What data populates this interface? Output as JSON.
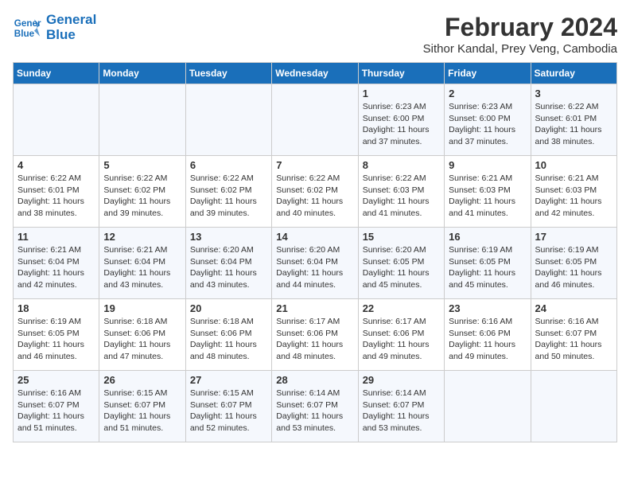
{
  "logo": {
    "line1": "General",
    "line2": "Blue"
  },
  "title": "February 2024",
  "subtitle": "Sithor Kandal, Prey Veng, Cambodia",
  "headers": [
    "Sunday",
    "Monday",
    "Tuesday",
    "Wednesday",
    "Thursday",
    "Friday",
    "Saturday"
  ],
  "weeks": [
    [
      {
        "day": "",
        "info": ""
      },
      {
        "day": "",
        "info": ""
      },
      {
        "day": "",
        "info": ""
      },
      {
        "day": "",
        "info": ""
      },
      {
        "day": "1",
        "info": "Sunrise: 6:23 AM\nSunset: 6:00 PM\nDaylight: 11 hours\nand 37 minutes."
      },
      {
        "day": "2",
        "info": "Sunrise: 6:23 AM\nSunset: 6:00 PM\nDaylight: 11 hours\nand 37 minutes."
      },
      {
        "day": "3",
        "info": "Sunrise: 6:22 AM\nSunset: 6:01 PM\nDaylight: 11 hours\nand 38 minutes."
      }
    ],
    [
      {
        "day": "4",
        "info": "Sunrise: 6:22 AM\nSunset: 6:01 PM\nDaylight: 11 hours\nand 38 minutes."
      },
      {
        "day": "5",
        "info": "Sunrise: 6:22 AM\nSunset: 6:02 PM\nDaylight: 11 hours\nand 39 minutes."
      },
      {
        "day": "6",
        "info": "Sunrise: 6:22 AM\nSunset: 6:02 PM\nDaylight: 11 hours\nand 39 minutes."
      },
      {
        "day": "7",
        "info": "Sunrise: 6:22 AM\nSunset: 6:02 PM\nDaylight: 11 hours\nand 40 minutes."
      },
      {
        "day": "8",
        "info": "Sunrise: 6:22 AM\nSunset: 6:03 PM\nDaylight: 11 hours\nand 41 minutes."
      },
      {
        "day": "9",
        "info": "Sunrise: 6:21 AM\nSunset: 6:03 PM\nDaylight: 11 hours\nand 41 minutes."
      },
      {
        "day": "10",
        "info": "Sunrise: 6:21 AM\nSunset: 6:03 PM\nDaylight: 11 hours\nand 42 minutes."
      }
    ],
    [
      {
        "day": "11",
        "info": "Sunrise: 6:21 AM\nSunset: 6:04 PM\nDaylight: 11 hours\nand 42 minutes."
      },
      {
        "day": "12",
        "info": "Sunrise: 6:21 AM\nSunset: 6:04 PM\nDaylight: 11 hours\nand 43 minutes."
      },
      {
        "day": "13",
        "info": "Sunrise: 6:20 AM\nSunset: 6:04 PM\nDaylight: 11 hours\nand 43 minutes."
      },
      {
        "day": "14",
        "info": "Sunrise: 6:20 AM\nSunset: 6:04 PM\nDaylight: 11 hours\nand 44 minutes."
      },
      {
        "day": "15",
        "info": "Sunrise: 6:20 AM\nSunset: 6:05 PM\nDaylight: 11 hours\nand 45 minutes."
      },
      {
        "day": "16",
        "info": "Sunrise: 6:19 AM\nSunset: 6:05 PM\nDaylight: 11 hours\nand 45 minutes."
      },
      {
        "day": "17",
        "info": "Sunrise: 6:19 AM\nSunset: 6:05 PM\nDaylight: 11 hours\nand 46 minutes."
      }
    ],
    [
      {
        "day": "18",
        "info": "Sunrise: 6:19 AM\nSunset: 6:05 PM\nDaylight: 11 hours\nand 46 minutes."
      },
      {
        "day": "19",
        "info": "Sunrise: 6:18 AM\nSunset: 6:06 PM\nDaylight: 11 hours\nand 47 minutes."
      },
      {
        "day": "20",
        "info": "Sunrise: 6:18 AM\nSunset: 6:06 PM\nDaylight: 11 hours\nand 48 minutes."
      },
      {
        "day": "21",
        "info": "Sunrise: 6:17 AM\nSunset: 6:06 PM\nDaylight: 11 hours\nand 48 minutes."
      },
      {
        "day": "22",
        "info": "Sunrise: 6:17 AM\nSunset: 6:06 PM\nDaylight: 11 hours\nand 49 minutes."
      },
      {
        "day": "23",
        "info": "Sunrise: 6:16 AM\nSunset: 6:06 PM\nDaylight: 11 hours\nand 49 minutes."
      },
      {
        "day": "24",
        "info": "Sunrise: 6:16 AM\nSunset: 6:07 PM\nDaylight: 11 hours\nand 50 minutes."
      }
    ],
    [
      {
        "day": "25",
        "info": "Sunrise: 6:16 AM\nSunset: 6:07 PM\nDaylight: 11 hours\nand 51 minutes."
      },
      {
        "day": "26",
        "info": "Sunrise: 6:15 AM\nSunset: 6:07 PM\nDaylight: 11 hours\nand 51 minutes."
      },
      {
        "day": "27",
        "info": "Sunrise: 6:15 AM\nSunset: 6:07 PM\nDaylight: 11 hours\nand 52 minutes."
      },
      {
        "day": "28",
        "info": "Sunrise: 6:14 AM\nSunset: 6:07 PM\nDaylight: 11 hours\nand 53 minutes."
      },
      {
        "day": "29",
        "info": "Sunrise: 6:14 AM\nSunset: 6:07 PM\nDaylight: 11 hours\nand 53 minutes."
      },
      {
        "day": "",
        "info": ""
      },
      {
        "day": "",
        "info": ""
      }
    ]
  ]
}
